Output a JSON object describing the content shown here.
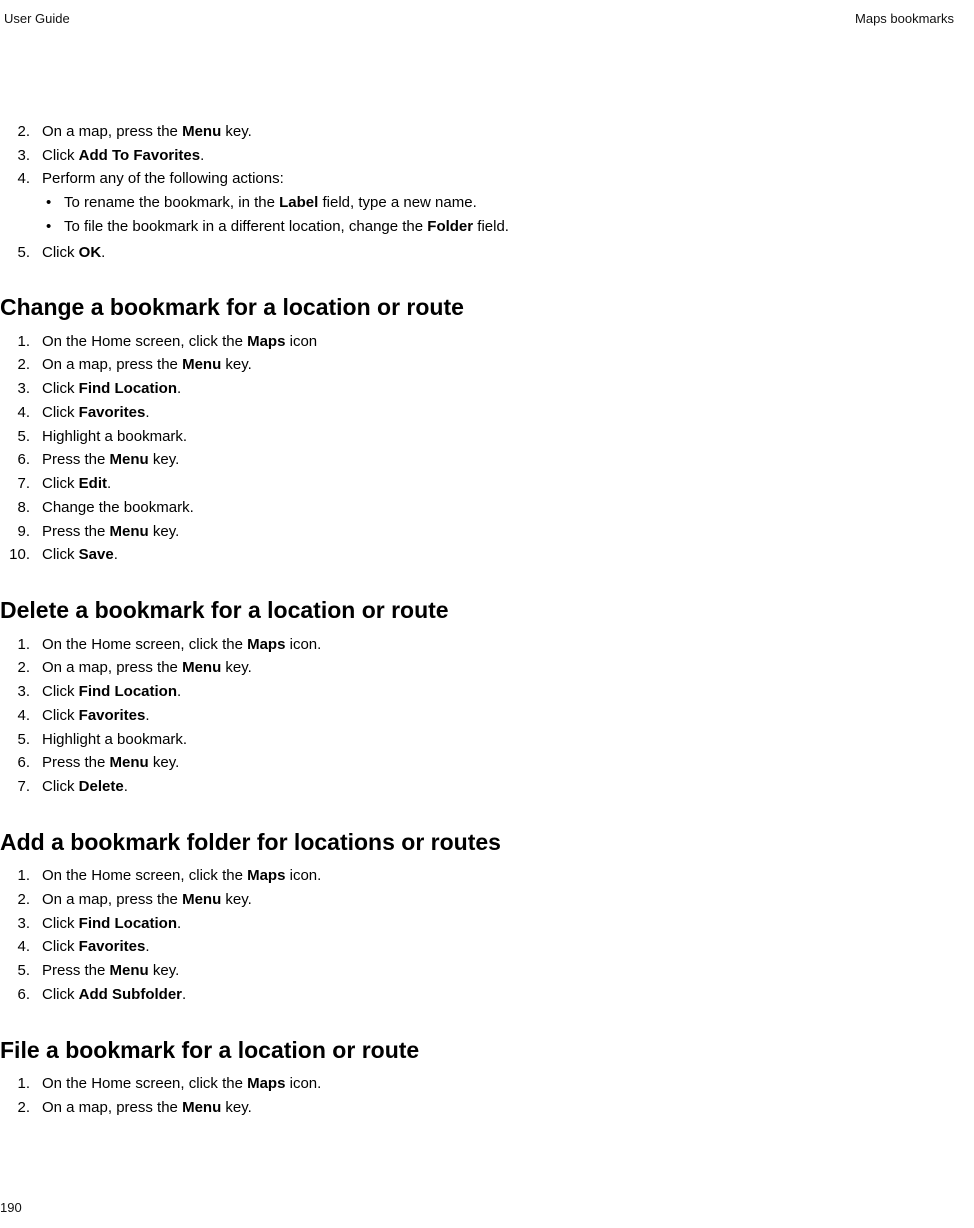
{
  "header": {
    "left": "User Guide",
    "right": "Maps bookmarks"
  },
  "page_number": "190",
  "intro_steps": [
    {
      "num": "2.",
      "segments": [
        {
          "t": "On a map, press the "
        },
        {
          "t": "Menu",
          "b": true
        },
        {
          "t": " key."
        }
      ]
    },
    {
      "num": "3.",
      "segments": [
        {
          "t": "Click "
        },
        {
          "t": "Add To Favorites",
          "b": true
        },
        {
          "t": "."
        }
      ]
    },
    {
      "num": "4.",
      "segments": [
        {
          "t": "Perform any of the following actions:"
        }
      ],
      "subitems": [
        {
          "segments": [
            {
              "t": "To rename the bookmark, in the "
            },
            {
              "t": "Label",
              "b": true
            },
            {
              "t": " field, type a new name."
            }
          ]
        },
        {
          "segments": [
            {
              "t": "To file the bookmark in a different location, change the "
            },
            {
              "t": "Folder",
              "b": true
            },
            {
              "t": " field."
            }
          ]
        }
      ]
    },
    {
      "num": "5.",
      "segments": [
        {
          "t": "Click "
        },
        {
          "t": "OK",
          "b": true
        },
        {
          "t": "."
        }
      ]
    }
  ],
  "sections": [
    {
      "title": "Change a bookmark for a location or route",
      "steps": [
        {
          "num": "1.",
          "segments": [
            {
              "t": "On the Home screen, click the "
            },
            {
              "t": "Maps",
              "b": true
            },
            {
              "t": " icon"
            }
          ]
        },
        {
          "num": "2.",
          "segments": [
            {
              "t": "On a map, press the "
            },
            {
              "t": "Menu",
              "b": true
            },
            {
              "t": " key."
            }
          ]
        },
        {
          "num": "3.",
          "segments": [
            {
              "t": "Click "
            },
            {
              "t": "Find Location",
              "b": true
            },
            {
              "t": "."
            }
          ]
        },
        {
          "num": "4.",
          "segments": [
            {
              "t": "Click "
            },
            {
              "t": "Favorites",
              "b": true
            },
            {
              "t": "."
            }
          ]
        },
        {
          "num": "5.",
          "segments": [
            {
              "t": "Highlight a bookmark."
            }
          ]
        },
        {
          "num": "6.",
          "segments": [
            {
              "t": "Press the "
            },
            {
              "t": "Menu",
              "b": true
            },
            {
              "t": " key."
            }
          ]
        },
        {
          "num": "7.",
          "segments": [
            {
              "t": "Click "
            },
            {
              "t": "Edit",
              "b": true
            },
            {
              "t": "."
            }
          ]
        },
        {
          "num": "8.",
          "segments": [
            {
              "t": "Change the bookmark."
            }
          ]
        },
        {
          "num": "9.",
          "segments": [
            {
              "t": "Press the "
            },
            {
              "t": "Menu",
              "b": true
            },
            {
              "t": " key."
            }
          ]
        },
        {
          "num": "10.",
          "segments": [
            {
              "t": "Click "
            },
            {
              "t": "Save",
              "b": true
            },
            {
              "t": "."
            }
          ]
        }
      ]
    },
    {
      "title": "Delete a bookmark for a location or route",
      "steps": [
        {
          "num": "1.",
          "segments": [
            {
              "t": "On the Home screen, click the "
            },
            {
              "t": "Maps",
              "b": true
            },
            {
              "t": " icon."
            }
          ]
        },
        {
          "num": "2.",
          "segments": [
            {
              "t": "On a map, press the "
            },
            {
              "t": "Menu",
              "b": true
            },
            {
              "t": " key."
            }
          ]
        },
        {
          "num": "3.",
          "segments": [
            {
              "t": "Click "
            },
            {
              "t": "Find Location",
              "b": true
            },
            {
              "t": "."
            }
          ]
        },
        {
          "num": "4.",
          "segments": [
            {
              "t": "Click "
            },
            {
              "t": "Favorites",
              "b": true
            },
            {
              "t": "."
            }
          ]
        },
        {
          "num": "5.",
          "segments": [
            {
              "t": "Highlight a bookmark."
            }
          ]
        },
        {
          "num": "6.",
          "segments": [
            {
              "t": "Press the "
            },
            {
              "t": "Menu",
              "b": true
            },
            {
              "t": " key."
            }
          ]
        },
        {
          "num": "7.",
          "segments": [
            {
              "t": "Click "
            },
            {
              "t": "Delete",
              "b": true
            },
            {
              "t": "."
            }
          ]
        }
      ]
    },
    {
      "title": "Add a bookmark folder for locations or routes",
      "steps": [
        {
          "num": "1.",
          "segments": [
            {
              "t": "On the Home screen, click the "
            },
            {
              "t": "Maps",
              "b": true
            },
            {
              "t": " icon."
            }
          ]
        },
        {
          "num": "2.",
          "segments": [
            {
              "t": "On a map, press the "
            },
            {
              "t": "Menu",
              "b": true
            },
            {
              "t": " key."
            }
          ]
        },
        {
          "num": "3.",
          "segments": [
            {
              "t": "Click "
            },
            {
              "t": "Find Location",
              "b": true
            },
            {
              "t": "."
            }
          ]
        },
        {
          "num": "4.",
          "segments": [
            {
              "t": "Click "
            },
            {
              "t": "Favorites",
              "b": true
            },
            {
              "t": "."
            }
          ]
        },
        {
          "num": "5.",
          "segments": [
            {
              "t": "Press the "
            },
            {
              "t": "Menu",
              "b": true
            },
            {
              "t": " key."
            }
          ]
        },
        {
          "num": "6.",
          "segments": [
            {
              "t": "Click "
            },
            {
              "t": "Add Subfolder",
              "b": true
            },
            {
              "t": "."
            }
          ]
        }
      ]
    },
    {
      "title": "File a bookmark for a location or route",
      "steps": [
        {
          "num": "1.",
          "segments": [
            {
              "t": "On the Home screen, click the "
            },
            {
              "t": "Maps",
              "b": true
            },
            {
              "t": " icon."
            }
          ]
        },
        {
          "num": "2.",
          "segments": [
            {
              "t": "On a map, press the "
            },
            {
              "t": "Menu",
              "b": true
            },
            {
              "t": " key."
            }
          ]
        }
      ]
    }
  ]
}
